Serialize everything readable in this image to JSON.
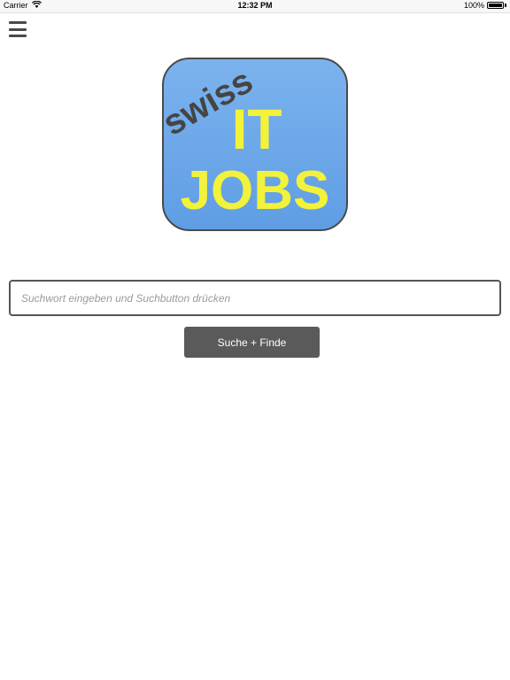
{
  "status_bar": {
    "carrier": "Carrier",
    "time": "12:32 PM",
    "battery": "100%"
  },
  "menu": {
    "icon": "hamburger-menu-icon"
  },
  "logo": {
    "swiss_text": "swiss",
    "line1": "IT",
    "line2": "JOBS",
    "background_color": "#6aa6e8",
    "text_color": "#f2f23a"
  },
  "search": {
    "placeholder": "Suchwort eingeben und Suchbutton drücken",
    "value": ""
  },
  "search_button": {
    "label": "Suche + Finde"
  }
}
